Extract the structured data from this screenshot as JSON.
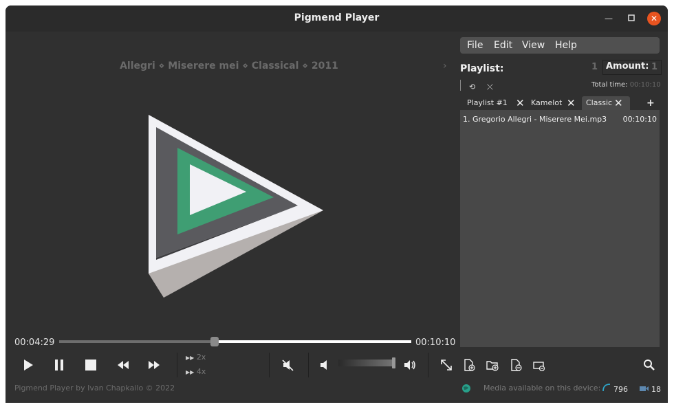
{
  "window": {
    "title": "Pigmend Player"
  },
  "player": {
    "now_playing": "Allegri ⋄ Miserere mei ⋄ Classical ⋄ 2011",
    "elapsed": "00:04:29",
    "duration": "00:10:10",
    "progress_fraction": 0.441,
    "speed_2x": "2x",
    "speed_4x": "4x",
    "volume_fraction": 0.95,
    "colors": {
      "accent_green": "#3f9e73",
      "logo_white": "#f1f1f5",
      "close_orange": "#e95420"
    }
  },
  "menu": {
    "file": "File",
    "edit": "Edit",
    "view": "View",
    "help": "Help"
  },
  "playlist": {
    "label": "Playlist:",
    "count": "1",
    "amount_label": "Amount:",
    "amount_value": "1",
    "total_time_label": "Total time:",
    "total_time_value": "00:10:10",
    "tabs": [
      {
        "label": "Playlist #1"
      },
      {
        "label": "Kamelot"
      },
      {
        "label": "Classic"
      }
    ],
    "add_tab": "+",
    "items": [
      {
        "name": "1.  Gregorio Allegri - Miserere Mei.mp3",
        "duration": "00:10:10"
      }
    ]
  },
  "footer": {
    "credit": "Pigmend Player by Ivan Chapkailo © 2022",
    "media_label": "Media available on this device:",
    "audio_count": "796",
    "video_count": "18"
  }
}
